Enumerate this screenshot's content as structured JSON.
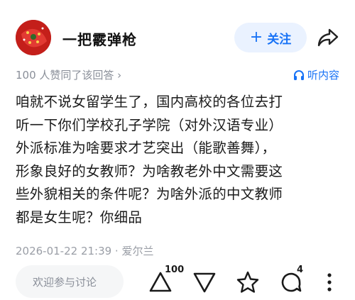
{
  "author": {
    "name": "一把霰弹枪",
    "follow_label": "关注",
    "follow_icon": "+"
  },
  "meta": {
    "upvote_summary": "100 人赞同了该回答 ›",
    "listen_label": "听内容"
  },
  "answer": {
    "lines": [
      "咱就不说女留学生了，国内高校的各位去打",
      "听一下你们学校孔子学院（对外汉语专业）",
      "外派标准为啥要求才艺突出（能歌善舞），",
      "形象良好的女教师？为啥教老外中文需要这",
      "些外貌相关的条件呢？为啥外派的中文教师",
      "都是女生呢？你细品"
    ]
  },
  "footer": {
    "timestamp_location": "2026-01-22 21:39 · 爱尔兰"
  },
  "actions": {
    "comment_placeholder": "欢迎参与讨论",
    "upvote_count": "100",
    "comment_count": "4"
  },
  "colors": {
    "accent": "#1772f6",
    "follow_bg": "#eaf2ff",
    "muted": "#8a8f99"
  }
}
